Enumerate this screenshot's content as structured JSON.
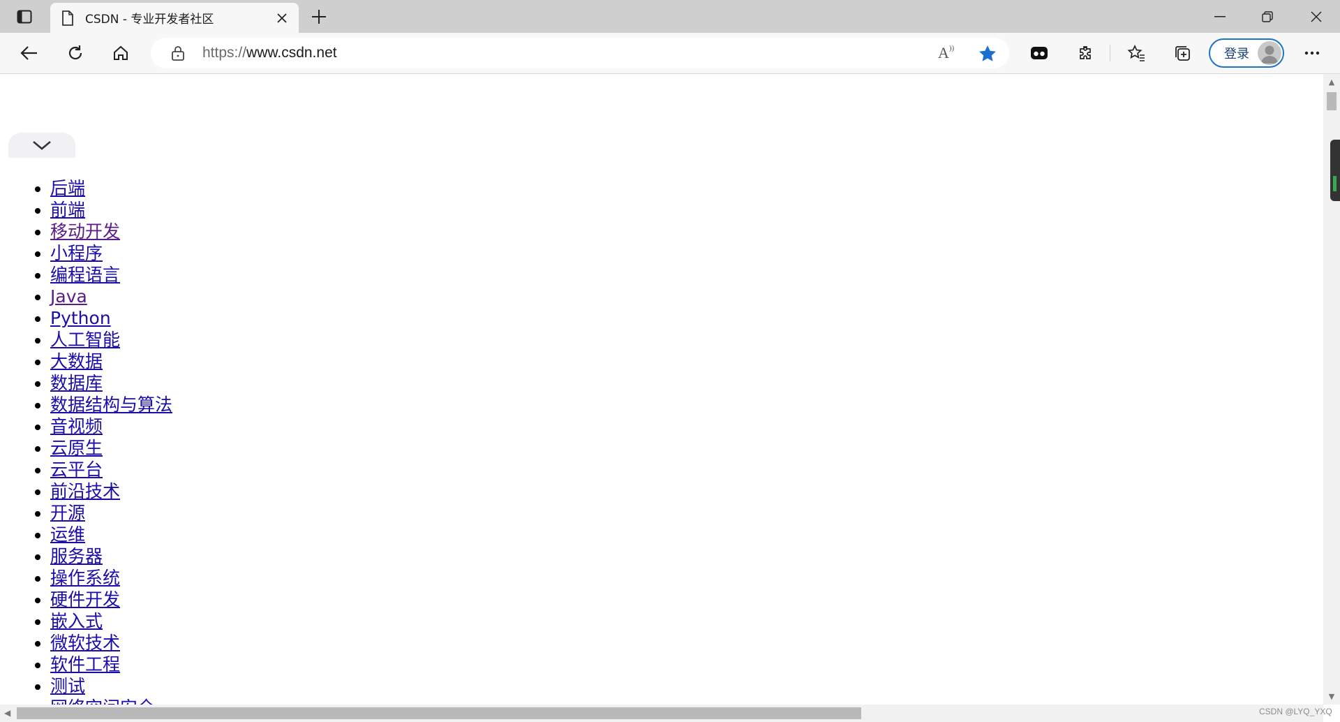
{
  "browser": {
    "tab": {
      "title": "CSDN - 专业开发者社区"
    },
    "address": {
      "protocol": "https://",
      "host": "www.csdn.net"
    },
    "signin_label": "登录",
    "colors": {
      "accent": "#1a73c7",
      "favorite_star": "#1a6fd0",
      "link": "#1a0dab",
      "visited_link": "#5b1b8a"
    },
    "icons": {
      "tab_actions": "tab-actions-icon",
      "new_tab": "plus-icon",
      "back": "back-arrow-icon",
      "refresh": "refresh-icon",
      "home": "home-icon",
      "lock": "lock-icon",
      "read_aloud": "read-aloud-icon",
      "favorite": "star-icon",
      "extensions": "puzzle-icon",
      "favorites": "favorites-icon",
      "collections": "collections-icon",
      "more": "more-icon"
    }
  },
  "page": {
    "categories": [
      "后端",
      "前端",
      "移动开发",
      "小程序",
      "编程语言",
      "Java",
      "Python",
      "人工智能",
      "大数据",
      "数据库",
      "数据结构与算法",
      "音视频",
      "云原生",
      "云平台",
      "前沿技术",
      "开源",
      "运维",
      "服务器",
      "操作系统",
      "硬件开发",
      "嵌入式",
      "微软技术",
      "软件工程",
      "测试",
      "网络空间安全"
    ],
    "visited_categories": [
      "移动开发",
      "Java"
    ]
  },
  "watermark": "CSDN @LYQ_YXQ"
}
